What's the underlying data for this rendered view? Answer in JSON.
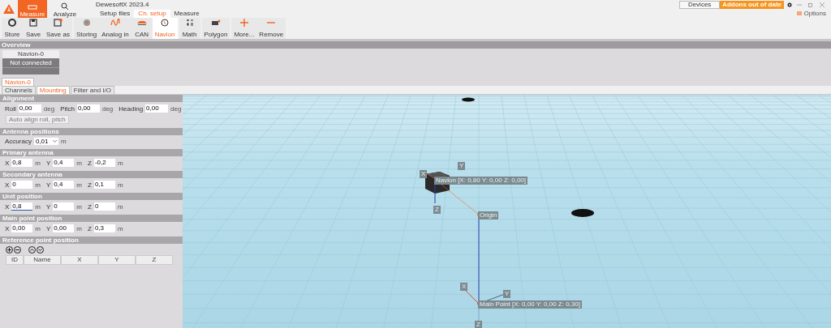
{
  "app": {
    "title": "DewesoftX 2023.4"
  },
  "modes": [
    {
      "label": "Measure",
      "selected": true
    },
    {
      "label": "Analyze",
      "selected": false
    }
  ],
  "subtabs": [
    {
      "label": "Setup files",
      "selected": false
    },
    {
      "label": "Ch. setup",
      "selected": true
    },
    {
      "label": "Measure",
      "selected": false
    }
  ],
  "header_right": {
    "devices": "Devices",
    "addons": "Addons out of date",
    "options": "Options"
  },
  "toolbar": [
    [
      {
        "kind": "store",
        "label": "Store",
        "selected": false
      },
      {
        "kind": "save",
        "label": "Save",
        "selected": false
      },
      {
        "kind": "saveas",
        "label": "Save as",
        "selected": false
      }
    ],
    [
      {
        "kind": "storing",
        "label": "Storing",
        "selected": false
      },
      {
        "kind": "analog",
        "label": "Analog in",
        "selected": false
      },
      {
        "kind": "can",
        "label": "CAN",
        "selected": false
      },
      {
        "kind": "navion",
        "label": "Navion",
        "selected": true
      }
    ],
    [
      {
        "kind": "math",
        "label": "Math",
        "selected": false
      }
    ],
    [
      {
        "kind": "polygon",
        "label": "Polygon",
        "selected": false
      }
    ],
    [
      {
        "kind": "more",
        "label": "More...",
        "selected": false
      },
      {
        "kind": "remove",
        "label": "Remove",
        "selected": false
      }
    ]
  ],
  "overview": {
    "title": "Overview",
    "device": "Navion-0",
    "status": "Not connected"
  },
  "device_tabs": [
    {
      "label": "Navion-0",
      "selected": true
    }
  ],
  "setup_tabs": [
    {
      "label": "Channels",
      "selected": false
    },
    {
      "label": "Mounting",
      "selected": true
    },
    {
      "label": "Filter and I/O",
      "selected": false
    }
  ],
  "sections": [
    {
      "title": "Alignment",
      "kind": "fields",
      "fields": [
        {
          "label": "Roll",
          "value": "0,00",
          "unit": "deg",
          "focused": false
        },
        {
          "label": "Pitch",
          "value": "0,00",
          "unit": "deg",
          "focused": false
        },
        {
          "label": "Heading",
          "value": "0,00",
          "unit": "deg",
          "focused": false
        }
      ],
      "button": "Auto align roll, pitch"
    },
    {
      "title": "Antenna positions",
      "kind": "select",
      "label": "Accuracy",
      "value": "0,01",
      "unit": "m"
    },
    {
      "title": "Primary antenna",
      "kind": "fields",
      "fields": [
        {
          "label": "X",
          "value": "0,8",
          "unit": "m",
          "focused": false
        },
        {
          "label": "Y",
          "value": "0,4",
          "unit": "m",
          "focused": false
        },
        {
          "label": "Z",
          "value": "-0,2",
          "unit": "m",
          "focused": false
        }
      ]
    },
    {
      "title": "Secondary antenna",
      "kind": "fields",
      "fields": [
        {
          "label": "X",
          "value": "0",
          "unit": "m",
          "focused": false
        },
        {
          "label": "Y",
          "value": "0,4",
          "unit": "m",
          "focused": false
        },
        {
          "label": "Z",
          "value": "0,1",
          "unit": "m",
          "focused": false
        }
      ]
    },
    {
      "title": "Unit position",
      "kind": "fields",
      "fields": [
        {
          "label": "X",
          "value": "0,8",
          "unit": "m",
          "focused": true
        },
        {
          "label": "Y",
          "value": "0",
          "unit": "m",
          "focused": false
        },
        {
          "label": "Z",
          "value": "0",
          "unit": "m",
          "focused": false
        }
      ]
    },
    {
      "title": "Main point position",
      "kind": "fields",
      "fields": [
        {
          "label": "X",
          "value": "0,00",
          "unit": "m",
          "focused": false
        },
        {
          "label": "Y",
          "value": "0,00",
          "unit": "m",
          "focused": false
        },
        {
          "label": "Z",
          "value": "0,3",
          "unit": "m",
          "focused": false
        }
      ]
    },
    {
      "title": "Reference point position",
      "kind": "table",
      "columns": [
        "ID",
        "Name",
        "X",
        "Y",
        "Z"
      ]
    }
  ],
  "scene": {
    "labels": [
      "Navion [X: 0,80 Y: 0,00 Z: 0,00]",
      "Origin",
      "Main Point [X: 0,00 Y: 0,00 Z: 0,30]",
      "X",
      "Y",
      "Z",
      "X",
      "Y",
      "Z"
    ]
  }
}
